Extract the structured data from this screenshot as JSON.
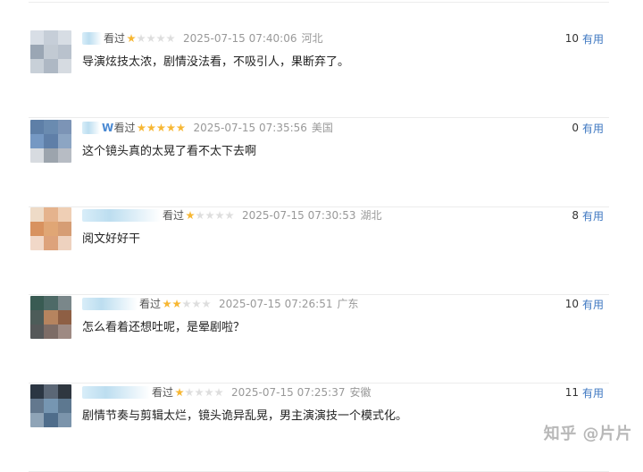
{
  "reviews": [
    {
      "username": "",
      "status": "看过",
      "time": "2025-07-15 07:40:06",
      "location": "河北",
      "comment": "导演炫技太浓，剧情没法看，不吸引人，果断弃了。",
      "useful_count": "10",
      "useful_label": "有用",
      "rating": 1
    },
    {
      "username": "W",
      "status": "看过",
      "time": "2025-07-15 07:35:56",
      "location": "美国",
      "comment": "这个镜头真的太晃了看不太下去啊",
      "useful_count": "0",
      "useful_label": "有用",
      "rating": 5
    },
    {
      "username": "",
      "status": "看过",
      "time": "2025-07-15 07:30:53",
      "location": "湖北",
      "comment": "阅文好好干",
      "useful_count": "8",
      "useful_label": "有用",
      "rating": 1
    },
    {
      "username": "",
      "status": "看过",
      "time": "2025-07-15 07:26:51",
      "location": "广东",
      "comment": "怎么看着还想吐呢，是晕剧啦？",
      "useful_count": "10",
      "useful_label": "有用",
      "rating": 2
    },
    {
      "username": "",
      "status": "看过",
      "time": "2025-07-15 07:25:37",
      "location": "安徽",
      "comment": "剧情节奏与剪辑太烂，镜头诡异乱晃，男主演演技一个模式化。",
      "useful_count": "11",
      "useful_label": "有用",
      "rating": 1
    }
  ],
  "watermark": "知乎 @片片",
  "colors": {
    "username_blue": "#4b8ad3",
    "useful_blue": "#3d77c1",
    "star_gold": "#f7b733",
    "star_gray": "#dedede",
    "meta_gray": "#999999"
  },
  "icons": {
    "star": "star-icon"
  }
}
